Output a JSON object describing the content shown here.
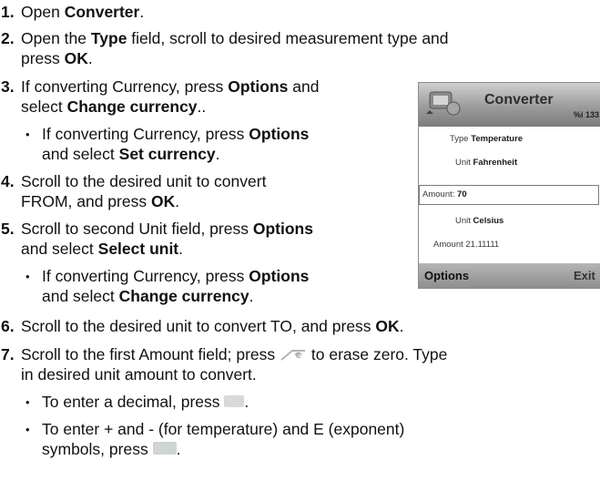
{
  "steps": [
    {
      "num": "1.",
      "pre": "Open ",
      "b1": "Converter",
      "post": "."
    },
    {
      "num": "2.",
      "pre": "Open the ",
      "b1": "Type",
      "mid": " field, scroll to desired measurement type and",
      "cont_pre": "press ",
      "cont_b": "OK",
      "cont_post": "."
    },
    {
      "num": "3.",
      "pre": "If converting Currency, press ",
      "b1": "Options",
      "post": " and",
      "cont_pre": "select ",
      "cont_b": "Change currency",
      "cont_post": ".."
    },
    {
      "num": "4.",
      "line1": "Scroll to the desired unit to convert",
      "cont_pre": "FROM, and press ",
      "cont_b": "OK",
      "cont_post": "."
    },
    {
      "num": "5.",
      "pre": "Scroll to second Unit field, press ",
      "b1": "Options",
      "cont_pre": "and select ",
      "cont_b": "Select unit",
      "cont_post": "."
    },
    {
      "num": "6.",
      "pre": "Scroll to the desired unit to convert TO, and press ",
      "b1": "OK",
      "post": "."
    },
    {
      "num": "7.",
      "pre": "Scroll to the first Amount field; press ",
      "post": " to erase zero. Type",
      "cont": "in desired unit amount to convert."
    }
  ],
  "bullets": [
    {
      "pre": "If converting Currency, press ",
      "b1": "Options",
      "cont_pre": "and select ",
      "cont_b": "Set currency",
      "cont_post": "."
    },
    {
      "pre": "If converting Currency, press ",
      "b1": "Options",
      "cont_pre": "and select ",
      "cont_b": "Change currency",
      "cont_post": "."
    },
    {
      "pre": "To enter a decimal, press ",
      "post": "."
    },
    {
      "line1": "To enter + and - (for temperature) and E (exponent)",
      "cont_pre": "symbols, press ",
      "cont_post": "."
    }
  ],
  "bullet_char": "•",
  "phone": {
    "title": "Converter",
    "signal": "%i 133",
    "type_label": "Type",
    "type_value": "Temperature",
    "unit1_label": "Unit",
    "unit1_value": "Fahrenheit",
    "amount1_label": "Amount:",
    "amount1_value": "70",
    "unit2_label": "Unit",
    "unit2_value": "Celsius",
    "amount2_label": "Amount",
    "amount2_value": "21.11111",
    "soft_left": "Options",
    "soft_right": "Exit"
  },
  "colors": {
    "text": "#111111",
    "phone_bar": "#9c9c9c"
  },
  "icons": [
    "clear-key-icon",
    "decimal-key-icon",
    "symbol-key-icon"
  ]
}
